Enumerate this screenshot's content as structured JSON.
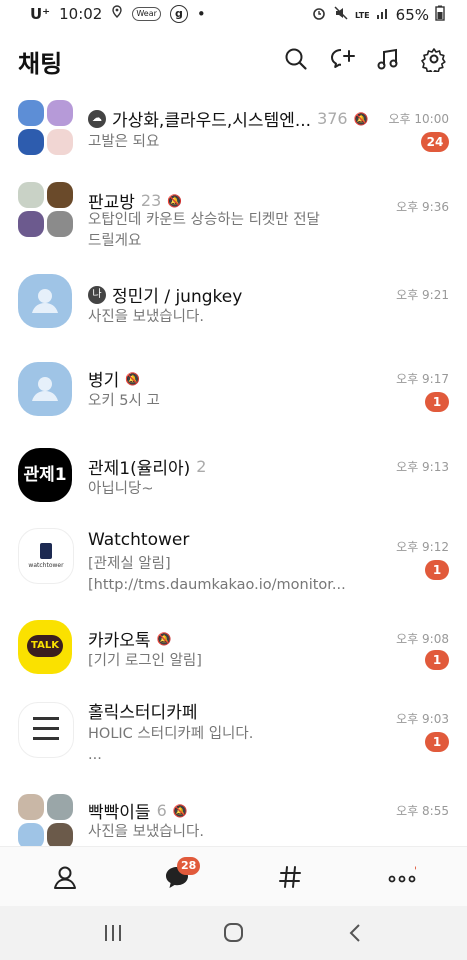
{
  "status": {
    "carrier": "U⁺",
    "time": "10:02",
    "wear": "Wear",
    "g": "g",
    "dot": "•",
    "lte": "LTE",
    "battery": "65%"
  },
  "header": {
    "title": "채팅"
  },
  "chats": [
    {
      "name": "가상화,클라우드,시스템엔...",
      "has_icon": true,
      "count": "376",
      "muted": true,
      "time": "오후 10:00",
      "message": "고발은 되요",
      "unread": "24"
    },
    {
      "name": "판교방",
      "count": "23",
      "muted": true,
      "time": "오후 9:36",
      "message": "오탑인데 카운트 상승하는 티켓만 전달\n드릴게요"
    },
    {
      "name": "정민기 / jungkey",
      "me_icon": "나",
      "time": "오후 9:21",
      "message": "사진을 보냈습니다."
    },
    {
      "name": "병기",
      "muted": true,
      "time": "오후 9:17",
      "message": "오키 5시 고",
      "unread": "1"
    },
    {
      "name": "관제1(율리아)",
      "count": "2",
      "time": "오후 9:13",
      "message": "아닙니당~",
      "avatar_text": "관제1"
    },
    {
      "name": "Watchtower",
      "time": "오후 9:12",
      "message": "[관제실 알림]\n[http://tms.daumkakao.io/monitor...",
      "unread": "1",
      "avatar_text": "watchtower"
    },
    {
      "name": "카카오톡",
      "muted": true,
      "time": "오후 9:08",
      "message": "[기기 로그인 알림]",
      "unread": "1",
      "avatar_text": "TALK"
    },
    {
      "name": "홀릭스터디카페",
      "time": "오후 9:03",
      "message": "HOLIC 스터디카페 입니다.\n...",
      "unread": "1"
    },
    {
      "name": "빡빡이들",
      "count": "6",
      "muted": true,
      "time": "오후 8:55",
      "message": "사진을 보냈습니다."
    }
  ],
  "tabbar": {
    "chat_badge": "28"
  },
  "colors": {
    "accent": "#e15a3b",
    "kakao_yellow": "#fae100",
    "default_avatar": "#9fc4e6"
  }
}
